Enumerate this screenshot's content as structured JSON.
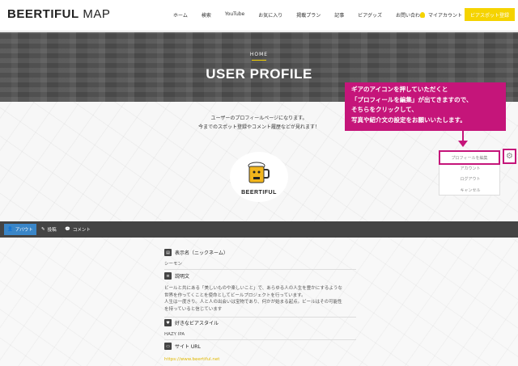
{
  "header": {
    "logo_bold": "BEERTIFUL",
    "logo_light": " MAP",
    "nav": [
      "ホーム",
      "検索",
      "YouTube",
      "お気に入り",
      "掲載プラン",
      "記事",
      "ビアグッズ",
      "お問い合わせ"
    ],
    "my_account": "マイアカウント",
    "register_button": "ビアスポット登録"
  },
  "hero": {
    "breadcrumb": "HOME",
    "title": "USER PROFILE"
  },
  "intro": {
    "line1": "ユーザーのプロフィールページになります。",
    "line2": "今までのスポット登録やコメント履歴などが見れます！"
  },
  "avatar": {
    "label": "BEERTIFUL"
  },
  "callout": {
    "line1": "ギアのアイコンを押していただくと",
    "line2": "「プロフィールを編集」が出てきますので、",
    "line3": "そちらをクリックして、",
    "line4": "写真や紹介文の設定をお願いいたします。"
  },
  "menu": {
    "edit_profile": "プロフィールを編集",
    "account": "アカウント",
    "logout": "ログアウト",
    "cancel": "キャンセル"
  },
  "tabs": {
    "about": "アバウト",
    "posts": "投稿",
    "comments": "コメント"
  },
  "profile": {
    "display_name_label": "表示名（ニックネーム）",
    "display_name": "シーモン",
    "description_label": "説明文",
    "description_lines": [
      "ビールと共にある「美しいものや楽しいこと」で、あらゆる人の人生を豊かにするような",
      "世界を作ってくことを使命としてビールプロジェクトを行っています。",
      "人生は一度きり。人と人の出会いは宝物であり、何かが始まる起点。ビールはその可能性",
      "を持っていると信じています"
    ],
    "favorite_style_label": "好きなビアスタイル",
    "favorite_style": "HAZY IPA",
    "site_url_label": "サイト URL",
    "site_url": "https://www.beertiful.net"
  },
  "colors": {
    "accent_yellow": "#f5d300",
    "callout_magenta": "#c5157a",
    "tab_active_blue": "#3a86c8",
    "tabbar_dark": "#444444"
  }
}
